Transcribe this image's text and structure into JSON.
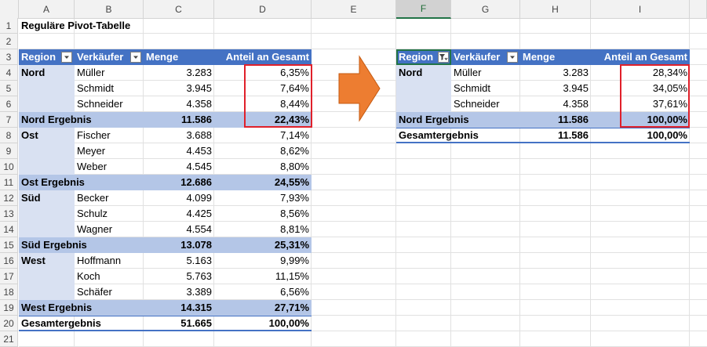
{
  "spreadsheet": {
    "columns": [
      "A",
      "B",
      "C",
      "D",
      "E",
      "F",
      "G",
      "H",
      "I"
    ],
    "selected_column": "F",
    "rows": [
      "1",
      "2",
      "3",
      "4",
      "5",
      "6",
      "7",
      "8",
      "9",
      "10",
      "11",
      "12",
      "13",
      "14",
      "15",
      "16",
      "17",
      "18",
      "19",
      "20",
      "21"
    ]
  },
  "title": "Reguläre Pivot-Tabelle",
  "pivot_left": {
    "headers": {
      "region": "Region",
      "seller": "Verkäufer",
      "qty": "Menge",
      "share": "Anteil an Gesamt"
    },
    "rows": [
      {
        "region": "Nord",
        "seller": "Müller",
        "qty": "3.283",
        "share": "6,35%"
      },
      {
        "region": "",
        "seller": "Schmidt",
        "qty": "3.945",
        "share": "7,64%"
      },
      {
        "region": "",
        "seller": "Schneider",
        "qty": "4.358",
        "share": "8,44%"
      },
      {
        "subtotal": "Nord Ergebnis",
        "qty": "11.586",
        "share": "22,43%"
      },
      {
        "region": "Ost",
        "seller": "Fischer",
        "qty": "3.688",
        "share": "7,14%"
      },
      {
        "region": "",
        "seller": "Meyer",
        "qty": "4.453",
        "share": "8,62%"
      },
      {
        "region": "",
        "seller": "Weber",
        "qty": "4.545",
        "share": "8,80%"
      },
      {
        "subtotal": "Ost Ergebnis",
        "qty": "12.686",
        "share": "24,55%"
      },
      {
        "region": "Süd",
        "seller": "Becker",
        "qty": "4.099",
        "share": "7,93%"
      },
      {
        "region": "",
        "seller": "Schulz",
        "qty": "4.425",
        "share": "8,56%"
      },
      {
        "region": "",
        "seller": "Wagner",
        "qty": "4.554",
        "share": "8,81%"
      },
      {
        "subtotal": "Süd Ergebnis",
        "qty": "13.078",
        "share": "25,31%"
      },
      {
        "region": "West",
        "seller": "Hoffmann",
        "qty": "5.163",
        "share": "9,99%"
      },
      {
        "region": "",
        "seller": "Koch",
        "qty": "5.763",
        "share": "11,15%"
      },
      {
        "region": "",
        "seller": "Schäfer",
        "qty": "3.389",
        "share": "6,56%"
      },
      {
        "subtotal": "West Ergebnis",
        "qty": "14.315",
        "share": "27,71%"
      },
      {
        "grand": "Gesamtergebnis",
        "qty": "51.665",
        "share": "100,00%"
      }
    ]
  },
  "pivot_right": {
    "headers": {
      "region": "Region",
      "seller": "Verkäufer",
      "qty": "Menge",
      "share": "Anteil an Gesamt"
    },
    "rows": [
      {
        "region": "Nord",
        "seller": "Müller",
        "qty": "3.283",
        "share": "28,34%"
      },
      {
        "region": "",
        "seller": "Schmidt",
        "qty": "3.945",
        "share": "34,05%"
      },
      {
        "region": "",
        "seller": "Schneider",
        "qty": "4.358",
        "share": "37,61%"
      },
      {
        "subtotal": "Nord Ergebnis",
        "qty": "11.586",
        "share": "100,00%"
      },
      {
        "grand": "Gesamtergebnis",
        "qty": "11.586",
        "share": "100,00%"
      }
    ]
  },
  "colors": {
    "header_fill": "#4472c4",
    "subtotal_fill": "#b4c6e7",
    "region_fill": "#d9e1f2",
    "highlight": "#e0202a",
    "arrow": "#ed7d31"
  }
}
